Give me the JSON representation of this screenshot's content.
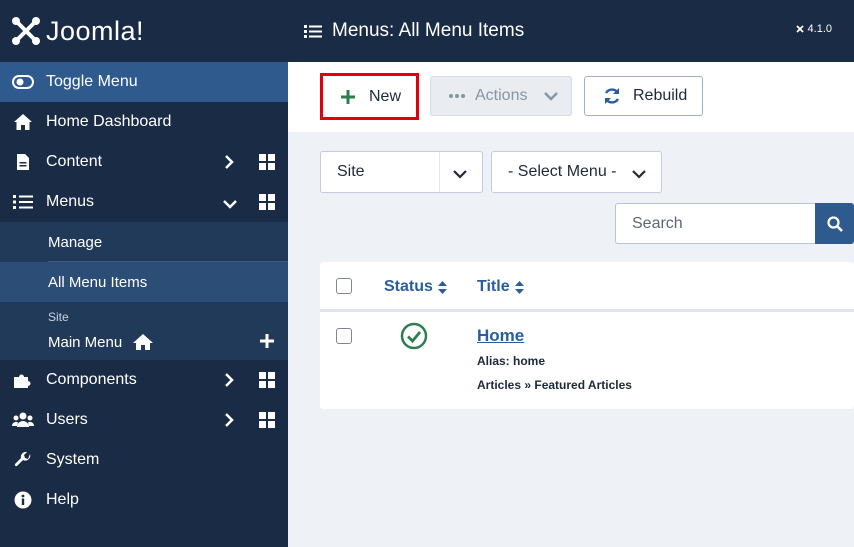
{
  "brand": {
    "name": "Joomla!",
    "version": "4.1.0"
  },
  "header": {
    "title": "Menus: All Menu Items"
  },
  "sidebar": {
    "toggle_label": "Toggle Menu",
    "items": [
      {
        "label": "Home Dashboard"
      },
      {
        "label": "Content"
      },
      {
        "label": "Menus"
      }
    ],
    "menus_sub": [
      {
        "label": "Manage"
      },
      {
        "label": "All Menu Items"
      }
    ],
    "site_label": "Site",
    "main_menu_label": "Main Menu",
    "bottom_items": [
      {
        "label": "Components"
      },
      {
        "label": "Users"
      },
      {
        "label": "System"
      },
      {
        "label": "Help"
      }
    ]
  },
  "toolbar": {
    "new_label": "New",
    "actions_label": "Actions",
    "rebuild_label": "Rebuild"
  },
  "filters": {
    "site_value": "Site",
    "menu_value": "- Select Menu -",
    "search_placeholder": "Search"
  },
  "table": {
    "columns": {
      "status": "Status",
      "title": "Title"
    },
    "rows": [
      {
        "title": "Home",
        "alias": "Alias: home",
        "type": "Articles » Featured Articles"
      }
    ]
  },
  "colors": {
    "sidebar_bg": "#1a2b45",
    "accent": "#2e5a8e",
    "link": "#2a5d9f",
    "status_ok": "#2f7d4f",
    "highlight": "#e0000f"
  }
}
